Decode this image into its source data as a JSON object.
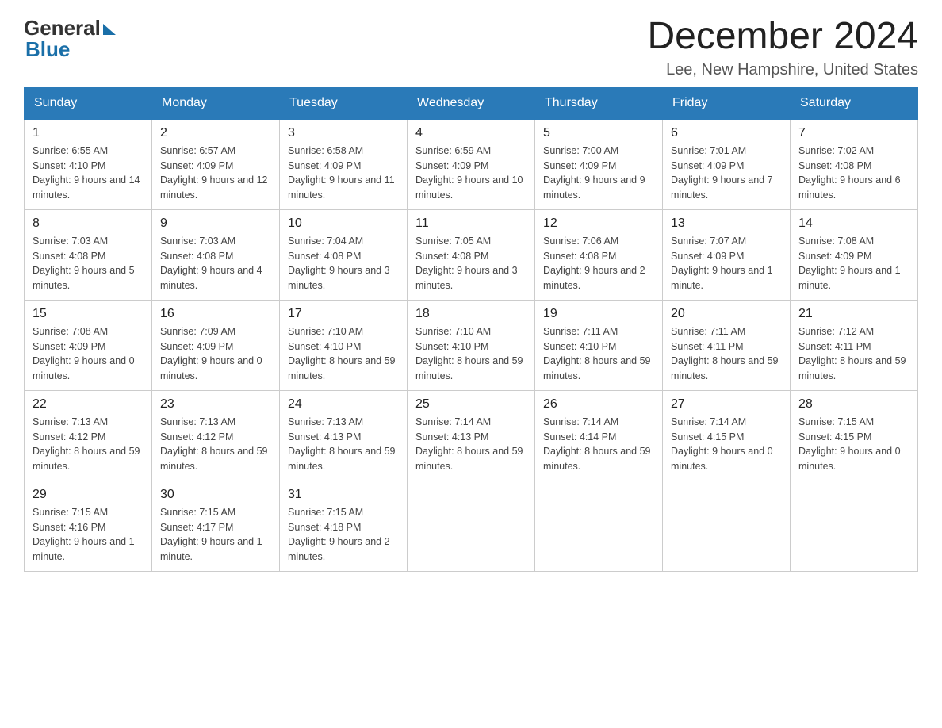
{
  "header": {
    "logo_general": "General",
    "logo_blue": "Blue",
    "month_title": "December 2024",
    "location": "Lee, New Hampshire, United States"
  },
  "days_of_week": [
    "Sunday",
    "Monday",
    "Tuesday",
    "Wednesday",
    "Thursday",
    "Friday",
    "Saturday"
  ],
  "weeks": [
    [
      {
        "day": "1",
        "sunrise": "6:55 AM",
        "sunset": "4:10 PM",
        "daylight": "9 hours and 14 minutes."
      },
      {
        "day": "2",
        "sunrise": "6:57 AM",
        "sunset": "4:09 PM",
        "daylight": "9 hours and 12 minutes."
      },
      {
        "day": "3",
        "sunrise": "6:58 AM",
        "sunset": "4:09 PM",
        "daylight": "9 hours and 11 minutes."
      },
      {
        "day": "4",
        "sunrise": "6:59 AM",
        "sunset": "4:09 PM",
        "daylight": "9 hours and 10 minutes."
      },
      {
        "day": "5",
        "sunrise": "7:00 AM",
        "sunset": "4:09 PM",
        "daylight": "9 hours and 9 minutes."
      },
      {
        "day": "6",
        "sunrise": "7:01 AM",
        "sunset": "4:09 PM",
        "daylight": "9 hours and 7 minutes."
      },
      {
        "day": "7",
        "sunrise": "7:02 AM",
        "sunset": "4:08 PM",
        "daylight": "9 hours and 6 minutes."
      }
    ],
    [
      {
        "day": "8",
        "sunrise": "7:03 AM",
        "sunset": "4:08 PM",
        "daylight": "9 hours and 5 minutes."
      },
      {
        "day": "9",
        "sunrise": "7:03 AM",
        "sunset": "4:08 PM",
        "daylight": "9 hours and 4 minutes."
      },
      {
        "day": "10",
        "sunrise": "7:04 AM",
        "sunset": "4:08 PM",
        "daylight": "9 hours and 3 minutes."
      },
      {
        "day": "11",
        "sunrise": "7:05 AM",
        "sunset": "4:08 PM",
        "daylight": "9 hours and 3 minutes."
      },
      {
        "day": "12",
        "sunrise": "7:06 AM",
        "sunset": "4:08 PM",
        "daylight": "9 hours and 2 minutes."
      },
      {
        "day": "13",
        "sunrise": "7:07 AM",
        "sunset": "4:09 PM",
        "daylight": "9 hours and 1 minute."
      },
      {
        "day": "14",
        "sunrise": "7:08 AM",
        "sunset": "4:09 PM",
        "daylight": "9 hours and 1 minute."
      }
    ],
    [
      {
        "day": "15",
        "sunrise": "7:08 AM",
        "sunset": "4:09 PM",
        "daylight": "9 hours and 0 minutes."
      },
      {
        "day": "16",
        "sunrise": "7:09 AM",
        "sunset": "4:09 PM",
        "daylight": "9 hours and 0 minutes."
      },
      {
        "day": "17",
        "sunrise": "7:10 AM",
        "sunset": "4:10 PM",
        "daylight": "8 hours and 59 minutes."
      },
      {
        "day": "18",
        "sunrise": "7:10 AM",
        "sunset": "4:10 PM",
        "daylight": "8 hours and 59 minutes."
      },
      {
        "day": "19",
        "sunrise": "7:11 AM",
        "sunset": "4:10 PM",
        "daylight": "8 hours and 59 minutes."
      },
      {
        "day": "20",
        "sunrise": "7:11 AM",
        "sunset": "4:11 PM",
        "daylight": "8 hours and 59 minutes."
      },
      {
        "day": "21",
        "sunrise": "7:12 AM",
        "sunset": "4:11 PM",
        "daylight": "8 hours and 59 minutes."
      }
    ],
    [
      {
        "day": "22",
        "sunrise": "7:13 AM",
        "sunset": "4:12 PM",
        "daylight": "8 hours and 59 minutes."
      },
      {
        "day": "23",
        "sunrise": "7:13 AM",
        "sunset": "4:12 PM",
        "daylight": "8 hours and 59 minutes."
      },
      {
        "day": "24",
        "sunrise": "7:13 AM",
        "sunset": "4:13 PM",
        "daylight": "8 hours and 59 minutes."
      },
      {
        "day": "25",
        "sunrise": "7:14 AM",
        "sunset": "4:13 PM",
        "daylight": "8 hours and 59 minutes."
      },
      {
        "day": "26",
        "sunrise": "7:14 AM",
        "sunset": "4:14 PM",
        "daylight": "8 hours and 59 minutes."
      },
      {
        "day": "27",
        "sunrise": "7:14 AM",
        "sunset": "4:15 PM",
        "daylight": "9 hours and 0 minutes."
      },
      {
        "day": "28",
        "sunrise": "7:15 AM",
        "sunset": "4:15 PM",
        "daylight": "9 hours and 0 minutes."
      }
    ],
    [
      {
        "day": "29",
        "sunrise": "7:15 AM",
        "sunset": "4:16 PM",
        "daylight": "9 hours and 1 minute."
      },
      {
        "day": "30",
        "sunrise": "7:15 AM",
        "sunset": "4:17 PM",
        "daylight": "9 hours and 1 minute."
      },
      {
        "day": "31",
        "sunrise": "7:15 AM",
        "sunset": "4:18 PM",
        "daylight": "9 hours and 2 minutes."
      },
      null,
      null,
      null,
      null
    ]
  ],
  "labels": {
    "sunrise": "Sunrise: ",
    "sunset": "Sunset: ",
    "daylight": "Daylight: "
  }
}
